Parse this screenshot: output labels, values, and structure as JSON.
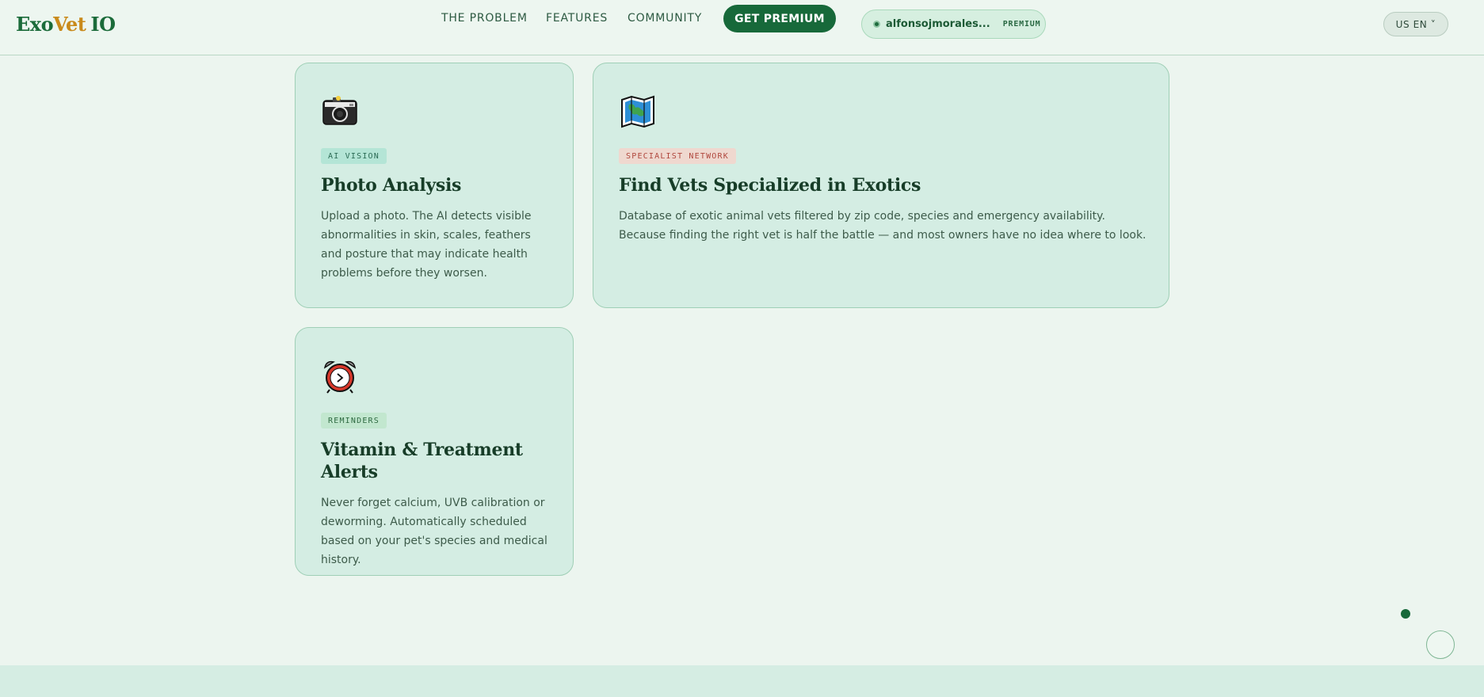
{
  "header": {
    "logo": {
      "part1": "Exo",
      "part2": "Vet",
      "part3": "IO"
    },
    "nav": {
      "problem": "THE PROBLEM",
      "features": "FEATURES",
      "community": "COMMUNITY"
    },
    "cta": "GET PREMIUM",
    "user": {
      "name": "alfonsojmorales...",
      "badge": "PREMIUM"
    },
    "lang": "US EN ˅"
  },
  "cards": [
    {
      "icon": "camera-icon",
      "tag": "AI VISION",
      "title": "Photo Analysis",
      "text": "Upload a photo. The AI detects visible abnormalities in skin, scales, feathers and posture that may indicate health problems before they worsen."
    },
    {
      "icon": "map-icon",
      "tag": "SPECIALIST NETWORK",
      "title": "Find Vets Specialized in Exotics",
      "text": "Database of exotic animal vets filtered by zip code, species and emergency availability. Because finding the right vet is half the battle — and most owners have no idea where to look."
    },
    {
      "icon": "alarm-clock-icon",
      "tag": "REMINDERS",
      "title": "Vitamin & Treatment Alerts",
      "text": "Never forget calcium, UVB calibration or deworming. Automatically scheduled based on your pet's species and medical history."
    }
  ],
  "colors": {
    "brand_green": "#17693a",
    "accent_gold": "#c98a1b",
    "card_bg": "#d4ede3",
    "page_bg": "#ecf5ef"
  }
}
